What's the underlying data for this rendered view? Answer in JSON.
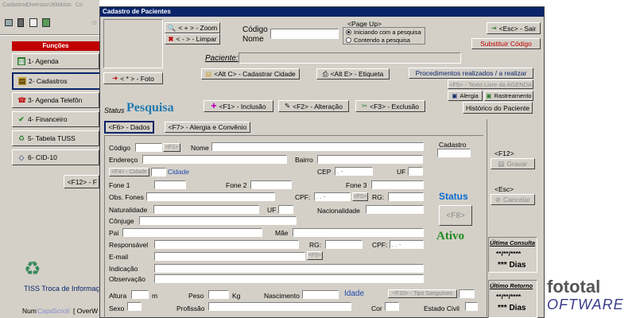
{
  "main_menu": [
    "Cadastros",
    "Diversos",
    "Utilitários",
    "Co"
  ],
  "dialog_title": "Cadastro de Pacientes",
  "funcoes": {
    "header": "Funções",
    "items": [
      {
        "label": "1- Agenda"
      },
      {
        "label": "2- Cadastros"
      },
      {
        "label": "3- Agenda Telefôn"
      },
      {
        "label": "4- Financeiro"
      },
      {
        "label": "5- Tabela TUSS"
      },
      {
        "label": "6- CID-10"
      }
    ],
    "f12_btn": "<F12> - F"
  },
  "tiss_text": "TISS Troca de Informaç",
  "statusbar": {
    "num": "Num",
    "caps": "Caps",
    "scroll": "Scroll",
    "overw": "[ OverW"
  },
  "fototal": {
    "line1": "fototal",
    "line2": "OFTWARE"
  },
  "toolbar": {
    "zoom": "< + > - Zoom",
    "limpar": "< - > - Limpar",
    "codigo_label": "Código",
    "nome_label": "Nome",
    "pageup_label": "<Page Up>",
    "opt_inicia": "Iniciando com a pesquisa",
    "opt_contem": "Contendo a pesquisa",
    "sair": "<Esc> - Sair",
    "substituir": "Substituir Código",
    "foto_btn": "< * > - Foto",
    "paciente_label": "Paciente:",
    "cadastrar_cidade": "<Alt C> - Cadastrar Cidade",
    "etiqueta": "<Alt E> - Etiqueta",
    "procedimentos": "Procedimentos realizados / a realizar",
    "texto_livre": "<F5> - Texto Livre da AGENDA",
    "alergia": "Alergia",
    "rastreamento": "Rastreamento",
    "status_label": "Status",
    "status_value": "Pesquisa",
    "inclusao": "<F1> - Inclusão",
    "alteracao": "<F2> - Alteração",
    "exclusao": "<F3> - Exclusão",
    "historico": "Histórico do Paciente"
  },
  "tabs": {
    "dados": "<F6> - Dados",
    "alergia": "<F7> - Alergia e Convênio"
  },
  "form": {
    "codigo": "Código",
    "f1": "<F1>",
    "nome": "Nome",
    "cadastro": "Cadastro",
    "endereco": "Endereço",
    "bairro": "Bairro",
    "f4_cidade": "<F4> - Cidade",
    "cidade": "Cidade",
    "cep": "CEP",
    "cep_mask": ". -",
    "uf": "UF",
    "fone1": "Fone 1",
    "fone2": "Fone 2",
    "fone3": "Fone 3",
    "obs_fones": "Obs. Fones",
    "cpf": "CPF:",
    "cpf_mask": ". . -",
    "f5": "<F5>",
    "rg": "RG:",
    "naturalidade": "Naturalidade",
    "nacionalidade": "Nacionalidade",
    "conjuge": "Cônjuge",
    "pai": "Pai",
    "mae": "Mãe",
    "responsavel": "Responsável",
    "email": "E-mail",
    "f9": "<F9>",
    "indicacao": "Indicação",
    "observacao": "Observação",
    "altura": "Altura",
    "m": "m",
    "peso": "Peso",
    "kg": "Kg",
    "nascimento": "Nascimento",
    "idade": "Idade",
    "f10_sangue": "<F10> - Tipo Sanguíneo",
    "sexo": "Sexo",
    "profissao": "Profissão",
    "cor": "Cor",
    "estado_civil": "Estado Civil",
    "status_title": "Status",
    "f8": "<F8>",
    "ativo": "Ativo"
  },
  "rightpanel": {
    "f12": "<F12>",
    "gravar": "Gravar",
    "esc": "<Esc>",
    "cancelar": "Cancelar",
    "ultima_consulta": "Última Consulta",
    "ultima_consulta_date": "**/**/****",
    "ultima_consulta_dias": "*** Dias",
    "ultimo_retorno": "Último Retorno",
    "ultimo_retorno_date": "**/**/****",
    "ultimo_retorno_dias": "*** Dias"
  },
  "colors": {
    "navy": "#0a246a",
    "status_blue": "#1f7ab0",
    "ativo_green": "#1f8a1f",
    "red": "#c00000",
    "dialog_bg": "#d4d0c8"
  }
}
